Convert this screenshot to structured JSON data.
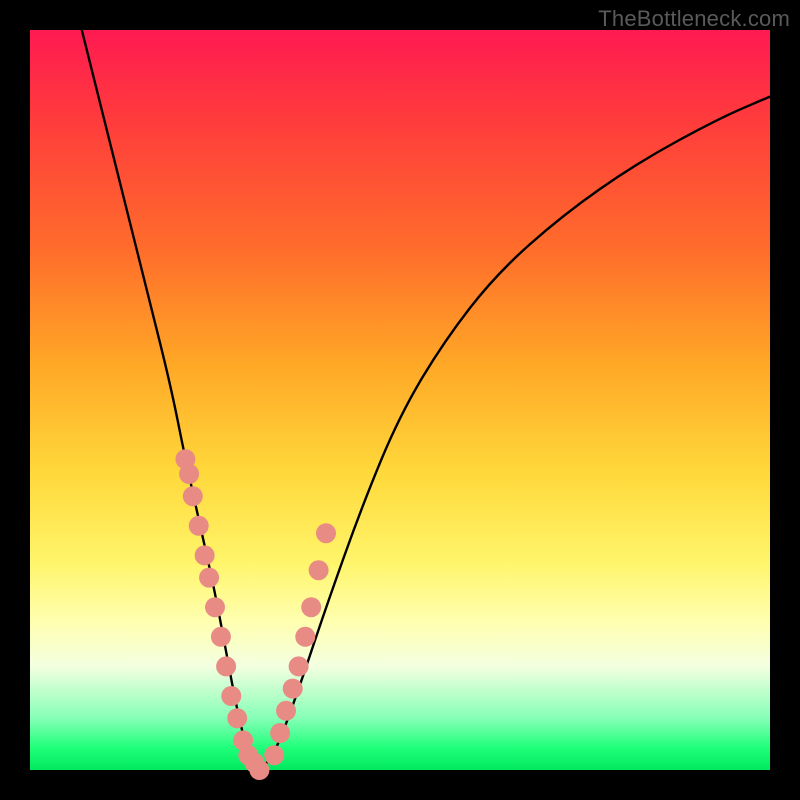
{
  "watermark": "TheBottleneck.com",
  "colors": {
    "curve_stroke": "#000000",
    "marker_fill": "#e98b85",
    "frame_bg": "#000000"
  },
  "chart_data": {
    "type": "line",
    "title": "",
    "xlabel": "",
    "ylabel": "",
    "xlim": [
      0,
      100
    ],
    "ylim": [
      0,
      100
    ],
    "series": [
      {
        "name": "bottleneck-curve",
        "x": [
          7,
          10,
          13,
          16,
          19,
          21,
          23,
          25,
          26.5,
          28,
          29.5,
          31,
          33,
          36,
          40,
          45,
          50,
          56,
          63,
          72,
          82,
          93,
          100
        ],
        "values": [
          100,
          88,
          76,
          64,
          52,
          42,
          33,
          24,
          16,
          8,
          2,
          0,
          2,
          10,
          22,
          36,
          48,
          58,
          67,
          75,
          82,
          88,
          91
        ]
      }
    ],
    "markers": {
      "name": "highlight-dots",
      "x_left": [
        21.0,
        21.5,
        22.0,
        22.8,
        23.6,
        24.2,
        25.0,
        25.8,
        26.5,
        27.2,
        28.0,
        28.8,
        29.5,
        30.3,
        31.0
      ],
      "y_left": [
        42,
        40,
        37,
        33,
        29,
        26,
        22,
        18,
        14,
        10,
        7,
        4,
        2,
        1,
        0
      ],
      "x_right": [
        33.0,
        33.8,
        34.6,
        35.5,
        36.3,
        37.2,
        38.0,
        39.0,
        40.0
      ],
      "y_right": [
        2,
        5,
        8,
        11,
        14,
        18,
        22,
        27,
        32
      ]
    }
  }
}
